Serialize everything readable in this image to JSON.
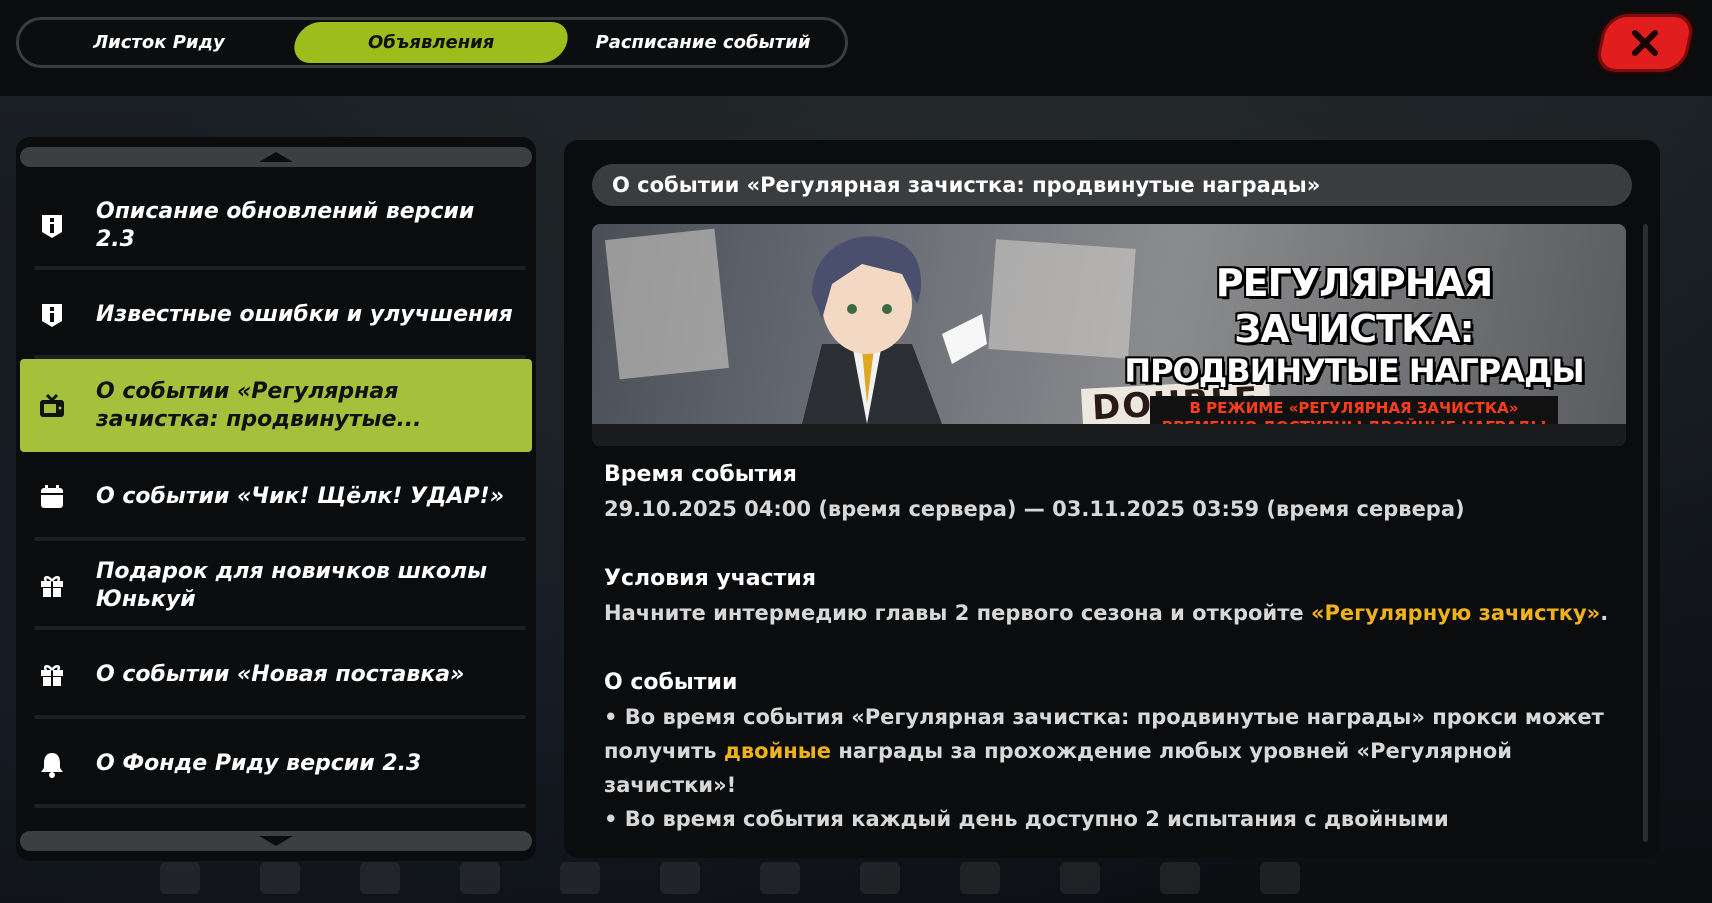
{
  "tabs": [
    {
      "label": "Листок Риду",
      "active": false
    },
    {
      "label": "Объявления",
      "active": true
    },
    {
      "label": "Расписание событий",
      "active": false
    }
  ],
  "close_icon": "close-icon",
  "sidebar": {
    "items": [
      {
        "icon": "info-icon",
        "label": "Описание обновлений версии 2.3",
        "active": false
      },
      {
        "icon": "info-icon",
        "label": "Известные ошибки и улучшения",
        "active": false
      },
      {
        "icon": "tv-icon",
        "label": "О событии «Регулярная зачистка: продвинутые...",
        "active": true
      },
      {
        "icon": "calendar-icon",
        "label": "О событии «Чик! Щёлк! УДАР!»",
        "active": false
      },
      {
        "icon": "gift-icon",
        "label": "Подарок для новичков школы Юнькуй",
        "active": false
      },
      {
        "icon": "gift-icon",
        "label": "О событии «Новая поставка»",
        "active": false
      },
      {
        "icon": "bell-icon",
        "label": "О Фонде Риду версии 2.3",
        "active": false
      }
    ]
  },
  "article": {
    "header": "О событии «Регулярная зачистка: продвинутые награды»",
    "banner": {
      "title_line1": "РЕГУЛЯРНАЯ ЗАЧИСТКА:",
      "title_line2": "ПРОДВИНУТЫЕ НАГРАДЫ",
      "subtitle_line1": "В РЕЖИМЕ «РЕГУЛЯРНАЯ ЗАЧИСТКА»",
      "subtitle_line2": "ВРЕМЕННО ДОСТУПНЫ ДВОЙНЫЕ НАГРАДЫ",
      "poster_text": "DOUBLE"
    },
    "time_title": "Время события",
    "time_value": "29.10.2025 04:00 (время сервера) — 03.11.2025 03:59 (время сервера)",
    "conditions_title": "Условия участия",
    "conditions_text": "Начните интермедию главы 2 первого сезона и откройте ",
    "conditions_link": "«Регулярную зачистку»",
    "conditions_end": ".",
    "about_title": "О событии",
    "about_p1_start": "• Во время события «Регулярная зачистка: продвинутые награды» прокси может получить ",
    "about_p1_hl": "двойные",
    "about_p1_end": " награды за прохождение любых уровней «Регулярной зачистки»!",
    "about_p2": "• Во время события каждый день доступно 2 испытания с двойными"
  },
  "colors": {
    "accent_green": "#9dbd1c",
    "active_item": "#a5c03a",
    "close_red": "#e11d1d",
    "highlight_gold": "#f0b21a"
  }
}
